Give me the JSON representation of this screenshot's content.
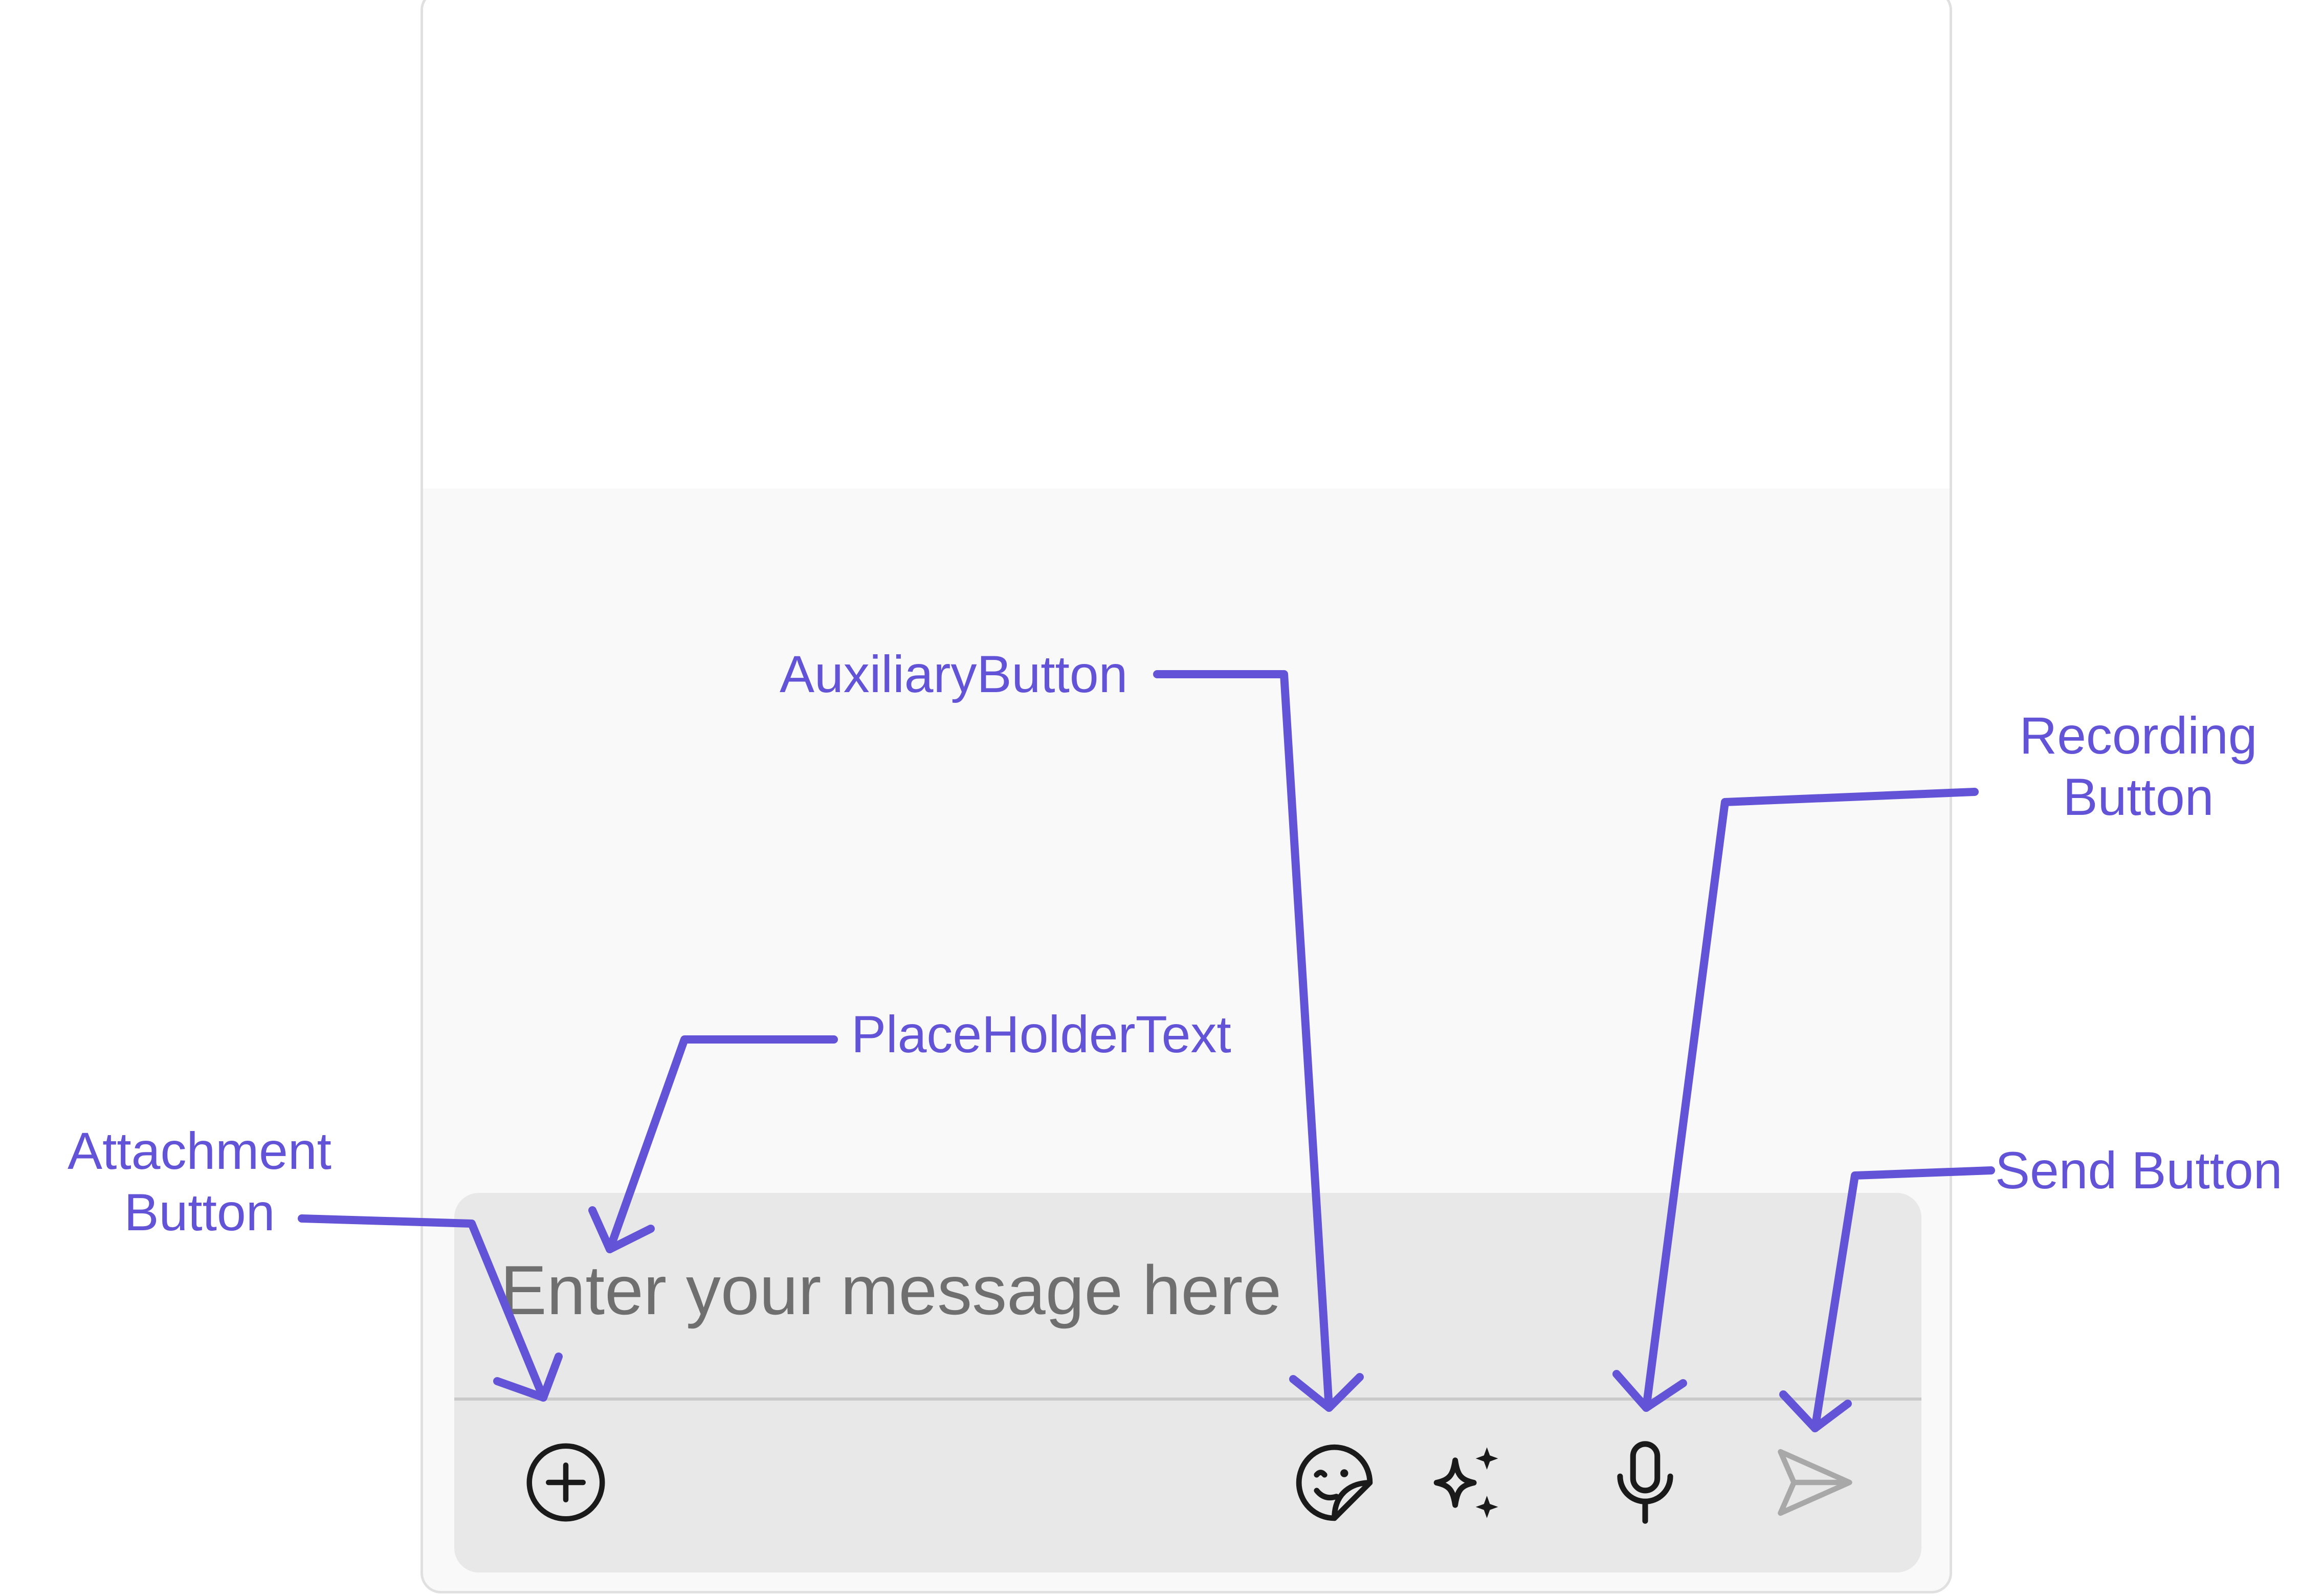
{
  "composer": {
    "placeholder": "Enter your message here",
    "buttons": {
      "attachment": "plus-circle-icon",
      "auxiliary": "sticker-icon",
      "ai": "sparkles-icon",
      "recording": "microphone-icon",
      "send": "send-icon"
    }
  },
  "annotations": {
    "attachment_line1": "Attachment",
    "attachment_line2": "Button",
    "placeholder": "PlaceHolderText",
    "auxiliary": "AuxiliaryButton",
    "recording_line1": "Recording",
    "recording_line2": "Button",
    "send": "Send Button"
  },
  "colors": {
    "annotation": "#6353d6",
    "composer_bg": "#e8e8e8",
    "placeholder": "#6f6f6f",
    "send_disabled": "#a8a8a8"
  }
}
